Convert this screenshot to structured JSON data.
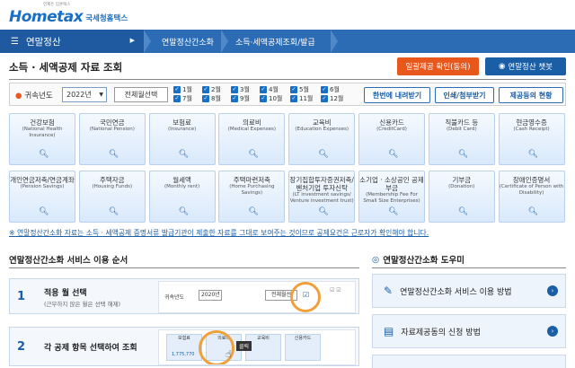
{
  "header": {
    "logo_text": "Hometax",
    "logo_sub": "국세청홈택스",
    "logo_tagline": "언제든 임혼택스"
  },
  "nav": {
    "menu_label": "연말정산",
    "items": [
      "연말정산간소화",
      "소득·세액공제조회/발급"
    ]
  },
  "title_row": {
    "title": "소득 · 세액공제 자료 조회",
    "consent_button": "일괄제공 확인(동의)",
    "chatbot_button": "연말정산 챗봇"
  },
  "filter": {
    "year_label": "귀속년도",
    "year_value": "2022년",
    "select_all": "전체월선택",
    "months": [
      [
        "1월",
        "7월"
      ],
      [
        "2월",
        "8월"
      ],
      [
        "3월",
        "9월"
      ],
      [
        "4월",
        "10월"
      ],
      [
        "5월",
        "11월"
      ],
      [
        "6월",
        "12월"
      ]
    ],
    "buttons": [
      "한번에 내려받기",
      "인쇄/첨부받기",
      "제공등의 현황"
    ]
  },
  "tiles": [
    {
      "name": "건강보험",
      "en": "(National Health Insurance)"
    },
    {
      "name": "국민연금",
      "en": "(National Pension)"
    },
    {
      "name": "보험료",
      "en": "(Insurance)"
    },
    {
      "name": "의료비",
      "en": "(Medical Expenses)"
    },
    {
      "name": "교육비",
      "en": "(Education Expenses)"
    },
    {
      "name": "신용카드",
      "en": "(CreditCard)"
    },
    {
      "name": "직불카드 등",
      "en": "(Debit Card)"
    },
    {
      "name": "현금영수증",
      "en": "(Cash Receipt)"
    },
    {
      "name": "개인연금저축/연금계좌",
      "en": "(Pension Savings)"
    },
    {
      "name": "주택자금",
      "en": "(Housing Funds)"
    },
    {
      "name": "월세액",
      "en": "(Monthly rent)"
    },
    {
      "name": "주택마련저축",
      "en": "(Home Purchasing Savings)"
    },
    {
      "name": "장기집합투자증권저축/벤처기업 투자신탁",
      "en": "(LT investment savings/ Venture investment trust)"
    },
    {
      "name": "소기업 · 소상공인 공제부금",
      "en": "(Membership Fee For Small Size Enterprises)"
    },
    {
      "name": "기부금",
      "en": "(Donation)"
    },
    {
      "name": "장애인증명서",
      "en": "(Certificate of Person with Disability)"
    }
  ],
  "notice": "※ 연말정산간소화 자료는 소득 · 세액공제 증명서류 발급기관이 제출한 자료를 그대로 보여주는 것이므로 공제요건은 근로자가 확인해야 합니다.",
  "usage": {
    "title": "연말정산간소화 서비스 이용 순서",
    "steps": [
      {
        "num": "1",
        "title": "적용 월 선택",
        "sub": "(근무하지 않은 월은 선택 해제)",
        "img_label": "귀속년도",
        "img_year": "2020년",
        "img_btn": "전체월선"
      },
      {
        "num": "2",
        "title": "각 공제 항목 선택하여 조회",
        "sub": "",
        "img_tiles": [
          "보험료",
          "의료비",
          "교육비",
          "신용카드"
        ],
        "img_value": "1,775,770",
        "img_click": "클릭"
      }
    ]
  },
  "help": {
    "title": "연말정산간소화 도우미",
    "items": [
      "연말정산간소화 서비스 이용 방법",
      "자료제공동의 신청 방법"
    ]
  }
}
